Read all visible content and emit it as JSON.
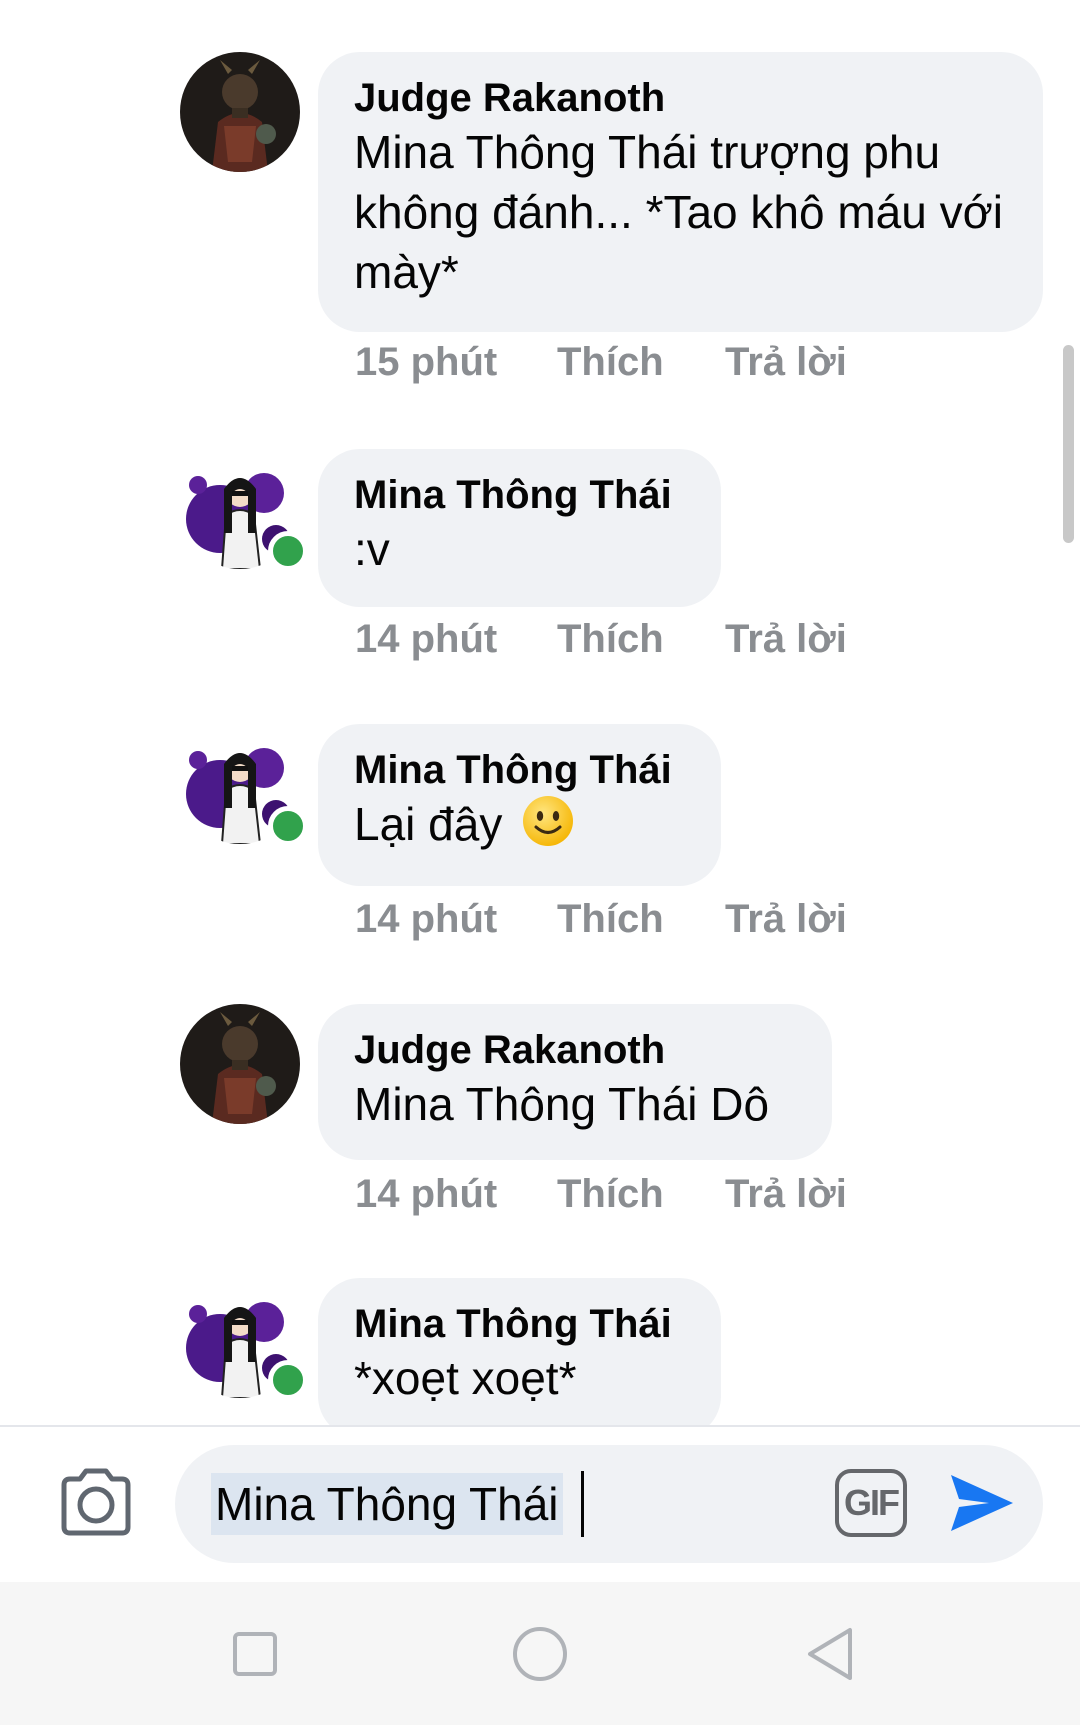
{
  "comments": [
    {
      "author": "Judge Rakanoth",
      "text": "Mina Thông Thái trượng phu không đánh... *Tao khô máu với mày*",
      "time": "15 phút",
      "like": "Thích",
      "reply": "Trả lời"
    },
    {
      "author": "Mina Thông Thái",
      "text": ":v",
      "time": "14 phút",
      "like": "Thích",
      "reply": "Trả lời"
    },
    {
      "author": "Mina Thông Thái",
      "text": "Lại đây",
      "emoji": "slightly-smiling-face-emoji",
      "time": "14 phút",
      "like": "Thích",
      "reply": "Trả lời"
    },
    {
      "author": "Judge Rakanoth",
      "text": "Mina Thông Thái Dô",
      "time": "14 phút",
      "like": "Thích",
      "reply": "Trả lời"
    },
    {
      "author": "Mina Thông Thái",
      "text": "*xoẹt xoẹt*"
    }
  ],
  "composer": {
    "input_value": "Mina Thông Thái",
    "gif_label": "GIF",
    "camera_icon": "camera-icon",
    "send_icon": "send-icon"
  },
  "navbar": {
    "icons": [
      "square-recent-apps-icon",
      "circle-home-icon",
      "triangle-back-icon"
    ]
  },
  "colors": {
    "bubble": "#f0f2f5",
    "meta_text": "#8a8d91",
    "online": "#31a24c",
    "send": "#1877f2"
  }
}
